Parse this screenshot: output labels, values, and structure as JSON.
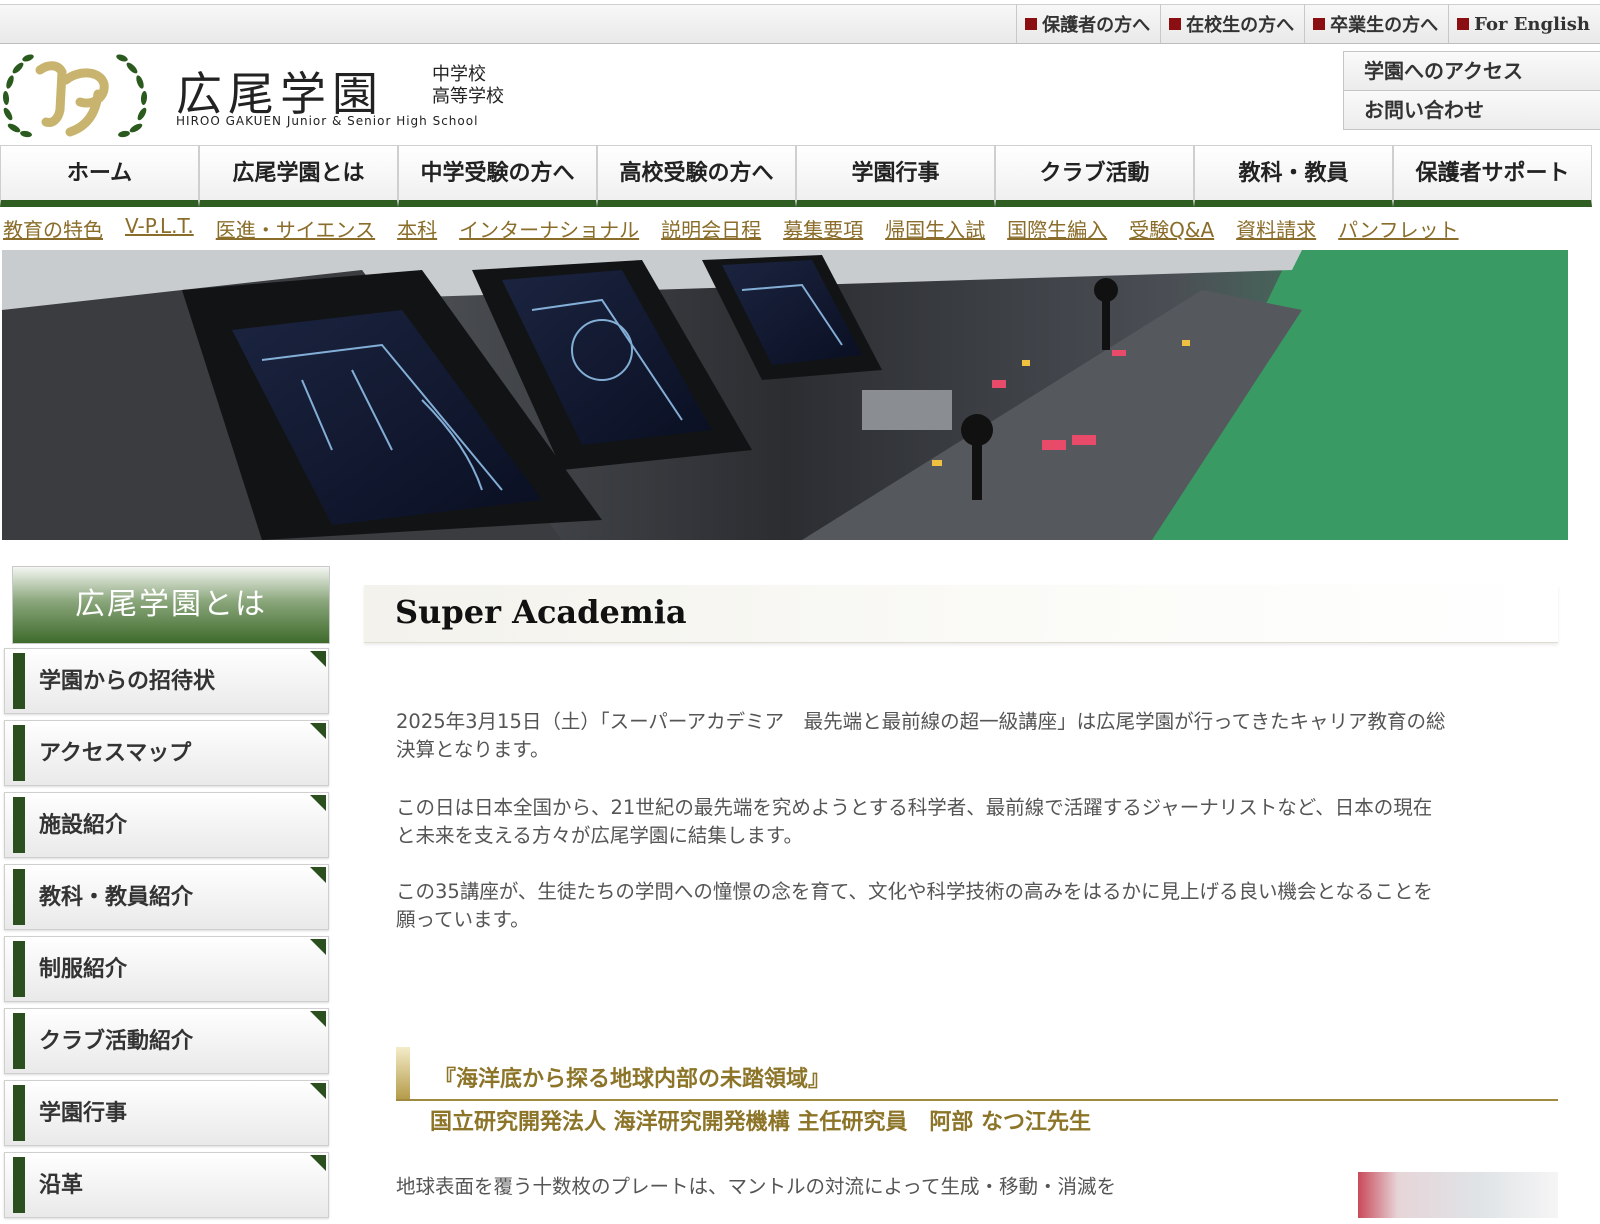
{
  "topbar": {
    "links": [
      "保護者の方へ",
      "在校生の方へ",
      "卒業生の方へ",
      "For English"
    ]
  },
  "header": {
    "name": "広尾学園",
    "sub_line1": "中学校",
    "sub_line2": "高等学校",
    "english": "HIROO GAKUEN Junior & Senior High School",
    "links": [
      "学園へのアクセス",
      "お問い合わせ"
    ]
  },
  "mainnav": [
    "ホーム",
    "広尾学園とは",
    "中学受験の方へ",
    "高校受験の方へ",
    "学園行事",
    "クラブ活動",
    "教科・教員",
    "保護者サポート"
  ],
  "subnav": [
    "教育の特色",
    "V-P.L.T.",
    "医進・サイエンス",
    "本科",
    "インターナショナル",
    "説明会日程",
    "募集要項",
    "帰国生入試",
    "国際生編入",
    "受験Q&A",
    "資料請求",
    "パンフレット"
  ],
  "sidebar": {
    "title": "広尾学園とは",
    "items": [
      "学園からの招待状",
      "アクセスマップ",
      "施設紹介",
      "教科・教員紹介",
      "制服紹介",
      "クラブ活動紹介",
      "学園行事",
      "沿革"
    ]
  },
  "content": {
    "title": "Super Academia",
    "p1_line1": "2025年3月15日（土）「スーパーアカデミア　最先端と最前線の超一級講座」は広尾学園が行ってきたキャリア教育の総",
    "p1_line2": "決算となります。",
    "p2_line1": "この日は日本全国から、21世紀の最先端を究めようとする科学者、最前線で活躍するジャーナリストなど、日本の現在",
    "p2_line2": "と未来を支える方々が広尾学園に結集します。",
    "p3_line1": "この35講座が、生徒たちの学問への憧憬の念を育て、文化や科学技術の高みをはるかに見上げる良い機会となることを",
    "p3_line2": "願っています。",
    "lecture_title": "『海洋底から探る地球内部の未踏領域』",
    "lecturer": "国立研究開発法人 海洋研究開発機構 主任研究員　阿部 なつ江先生",
    "lecture_text": "地球表面を覆う十数枚のプレートは、マントルの対流によって生成・移動・消滅を"
  },
  "colors": {
    "accent_green": "#2f5d22",
    "link_gold": "#8a6d2a",
    "marker_red": "#8b0e12"
  }
}
